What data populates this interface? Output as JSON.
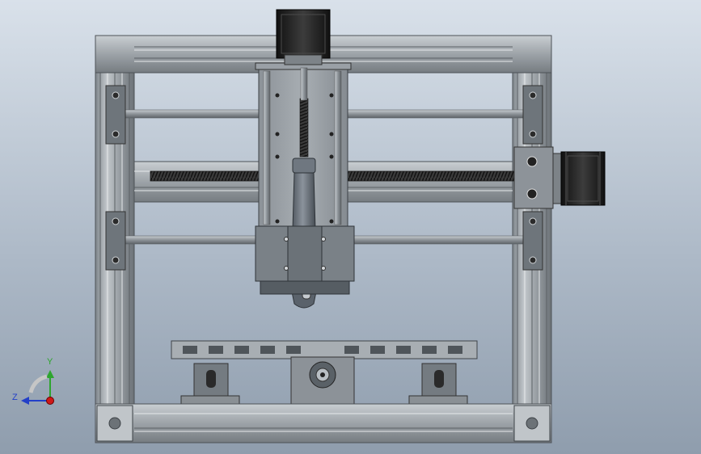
{
  "triad": {
    "y_label": "Y",
    "z_label": "Z",
    "y_color": "#2ea52e",
    "z_color": "#2340c8",
    "x_color": "#d01818"
  },
  "model": {
    "frame_color": "#a3a9ae",
    "frame_shadow": "#6e7479",
    "motor_color": "#2a2a2a",
    "rod_color": "#8e9499",
    "leadscrew_color": "#2b2b2b",
    "spindle_color": "#5f6670"
  }
}
